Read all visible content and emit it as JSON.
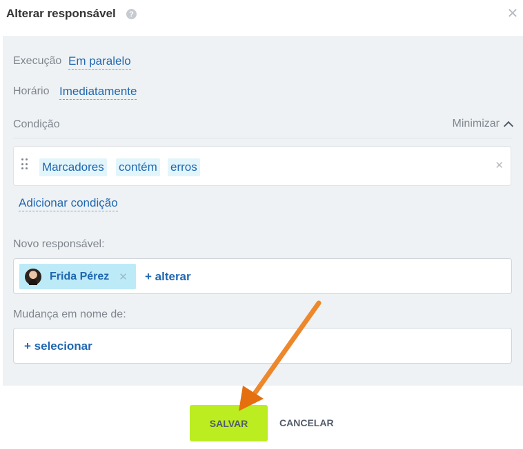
{
  "dialog": {
    "title": "Alterar responsável",
    "help_icon": "question-icon",
    "close_icon": "close-icon"
  },
  "settings": {
    "execution_label": "Execução",
    "execution_value": "Em paralelo",
    "schedule_label": "Horário",
    "schedule_value": "Imediatamente",
    "condition_label": "Condição",
    "minimize_label": "Minimizar"
  },
  "condition": {
    "field": "Marcadores",
    "operator": "contém",
    "value": "erros",
    "add_label": "Adicionar condição"
  },
  "new_responsible": {
    "label": "Novo responsável:",
    "user_name": "Frida Pérez",
    "change_label": "+ alterar"
  },
  "on_behalf": {
    "label": "Mudança em nome de:",
    "select_label": "+ selecionar"
  },
  "footer": {
    "save_label": "SALVAR",
    "cancel_label": "CANCELAR"
  },
  "colors": {
    "accent": "#2067b0",
    "save_button": "#bbed21",
    "panel_bg": "#eef2f4",
    "annotation_arrow": "#ef7d1a"
  }
}
